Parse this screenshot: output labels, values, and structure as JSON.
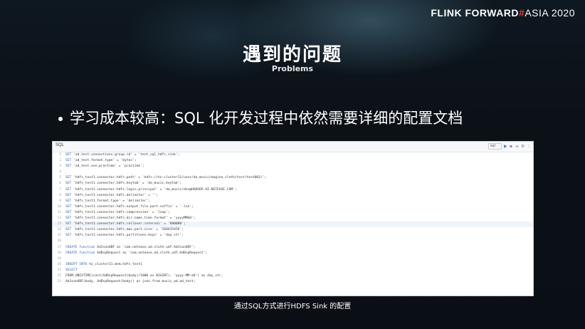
{
  "brand": {
    "part1": "FLINK FORWARD",
    "hash": "#",
    "part2": "ASIA 2020"
  },
  "slide": {
    "title": "遇到的问题",
    "subtitle": "Problems",
    "bullet": "学习成本较高：SQL 化开发过程中依然需要详细的配置文档",
    "caption": "通过SQL方式进行HDFS Sink 的配置"
  },
  "editor": {
    "tab": "SQL",
    "mode_select": "sql",
    "toolbar_icons": [
      "run-icon",
      "save-icon",
      "format-icon",
      "settings-icon",
      "more-icon"
    ],
    "lines": [
      {
        "n": "1",
        "kw": "SET",
        "rest": " 'ad_test.connections.group.id' = 'test_sql_hdfs_sink';"
      },
      {
        "n": "2",
        "kw": "SET",
        "rest": " 'ad_test.format.type' = 'bytes';"
      },
      {
        "n": "3",
        "kw": "SET",
        "rest": " 'ad_test.use.practime' = 'practime';"
      },
      {
        "n": "4",
        "kw": "",
        "rest": ""
      },
      {
        "n": "5",
        "kw": "SET",
        "rest": " 'hdfs_test1.connector.hdfs.path' = 'hdfs://hz-cluster11/user/da_music/magina_sloth/test/test003/';"
      },
      {
        "n": "6",
        "kw": "SET",
        "rest": " 'hdfs_test1.connector.hdfs.keytab' = 'da_music.keytab';"
      },
      {
        "n": "7",
        "kw": "SET",
        "rest": " 'hdfs_test1.connector.hdfs.login.principal' = 'da_music/dev@HADOOP.HZ.NETEASE.COM';"
      },
      {
        "n": "8",
        "kw": "SET",
        "rest": " 'hdfs_test1.connector.hdfs.delimiter' = '';"
      },
      {
        "n": "9",
        "kw": "SET",
        "rest": " 'hdfs_test1.format.type' = 'delimiter';"
      },
      {
        "n": "10",
        "kw": "SET",
        "rest": " 'hdfs_test1.connector.hdfs.output.file.part.suffix' = '.lzo';"
      },
      {
        "n": "11",
        "kw": "SET",
        "rest": " 'hdfs_test1.connector.hdfs.compression' = 'lzop';"
      },
      {
        "n": "12",
        "kw": "SET",
        "rest": " 'hdfs_test1.connector.hdfs.dir.name.time.format' = 'yyyyMMdd';"
      },
      {
        "n": "13",
        "kw": "SET",
        "rest": " 'hdfs_test1.connector.hdfs.rollover.interval' = '600000';"
      },
      {
        "n": "14",
        "kw": "SET",
        "rest": " 'hdfs_test1.connector.hdfs.max.part.size' = '268435456';"
      },
      {
        "n": "15",
        "kw": "SET",
        "rest": " 'hdfs_test1.connector.hdfs.partitions.keys' = 'day_str';"
      },
      {
        "n": "16",
        "kw": "",
        "rest": ""
      },
      {
        "n": "17",
        "kw": "CREATE function",
        "rest": " AdJsonUDF as 'com.netease.ad.sloth.udf.AdJsonUDF';"
      },
      {
        "n": "18",
        "kw": "CREATE function",
        "rest": " AdDspRequest as 'com.netease.ad.sloth.udf.AdDspRequest';"
      },
      {
        "n": "19",
        "kw": "",
        "rest": ""
      },
      {
        "n": "20",
        "kw": "INSERT INTO",
        "rest": " hz_cluster11.mem.hdfs_test1"
      },
      {
        "n": "21",
        "kw": "SELECT",
        "rest": ""
      },
      {
        "n": "22",
        "kw": "",
        "rest": "FROM_UNIXTIME(cast(AdDspRequest(body)/1000 as BIGINT), 'yyyy-MM-dd') as day_str,"
      },
      {
        "n": "23",
        "kw": "",
        "rest": "AdJsonUDF(body, AdDspRequest(body)) as json from music_ad.ad_test;"
      }
    ]
  },
  "colors": {
    "brand_hash": "#e23b3b",
    "keyword": "#2a5db0",
    "highlight_row": "#eef5fb"
  }
}
